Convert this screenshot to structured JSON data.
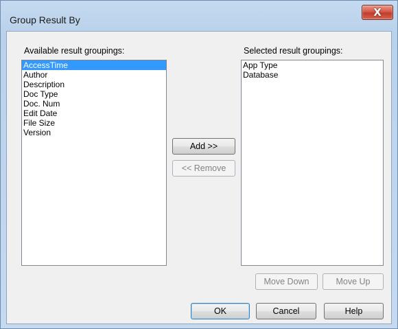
{
  "window": {
    "title": "Group Result By",
    "close_glyph": "X"
  },
  "available": {
    "label": "Available result groupings:",
    "items": [
      {
        "label": "AccessTime",
        "selected": true
      },
      {
        "label": "Author"
      },
      {
        "label": "Description"
      },
      {
        "label": "Doc Type"
      },
      {
        "label": "Doc. Num"
      },
      {
        "label": "Edit Date"
      },
      {
        "label": "File Size"
      },
      {
        "label": "Version"
      }
    ]
  },
  "selected_groupings": {
    "label": "Selected result groupings:",
    "items": [
      {
        "label": "App Type"
      },
      {
        "label": "Database"
      }
    ]
  },
  "buttons": {
    "add": "Add >>",
    "remove": "<< Remove",
    "move_down": "Move Down",
    "move_up": "Move Up",
    "ok": "OK",
    "cancel": "Cancel",
    "help": "Help"
  },
  "colors": {
    "selection": "#3399ff",
    "close_button": "#c43b2a"
  }
}
